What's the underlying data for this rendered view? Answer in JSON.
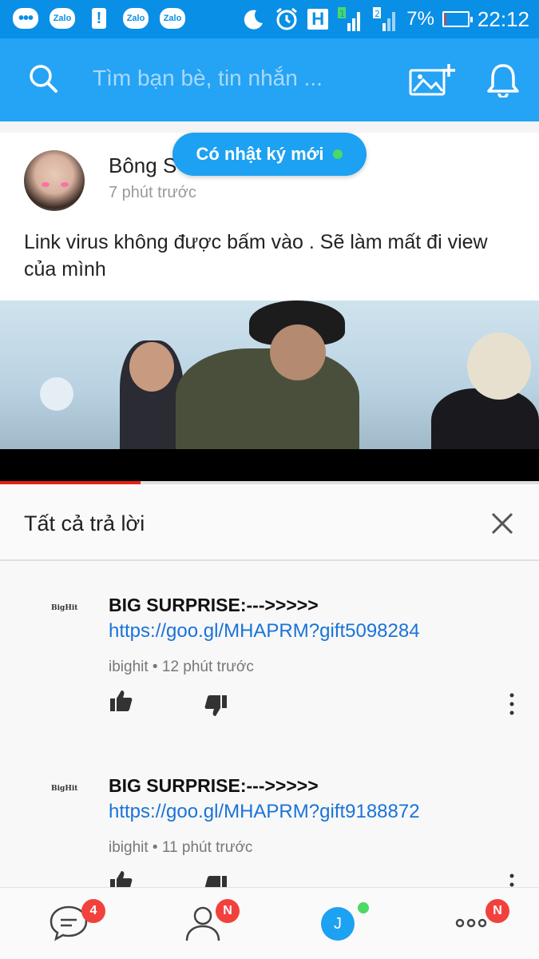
{
  "status_bar": {
    "zalo_labels": [
      "Zalo",
      "Zalo",
      "Zalo"
    ],
    "network": "H",
    "sim1": "1",
    "sim2": "2",
    "battery_percent": "7%",
    "battery_level": 0.07,
    "time": "22:12"
  },
  "top_bar": {
    "search_placeholder": "Tìm bạn bè, tin nhắn ...",
    "accent_color": "#25a3f5"
  },
  "new_diary_pill": {
    "label": "Có nhật ký mới"
  },
  "post": {
    "author": "Bông S",
    "time": "7 phút trước",
    "text": "Link virus không được bấm vào . Sẽ làm mất đi view của mình"
  },
  "embedded_screen": {
    "video_progress": 0.26,
    "replies_title": "Tất cả trả lời",
    "replies": [
      {
        "logo": "BigHit",
        "title": "BIG SURPRISE:--->>>>>",
        "link": "https://goo.gl/MHAPRM?gift5098284",
        "channel": "ibighit",
        "time": "12 phút trước"
      },
      {
        "logo": "BigHit",
        "title": "BIG SURPRISE:--->>>>>",
        "link": "https://goo.gl/MHAPRM?gift9188872",
        "channel": "ibighit",
        "time": "11 phút trước"
      }
    ]
  },
  "bottom_nav": {
    "messages_badge": "4",
    "contacts_badge": "N",
    "timeline_letter": "J",
    "more_badge": "N"
  }
}
